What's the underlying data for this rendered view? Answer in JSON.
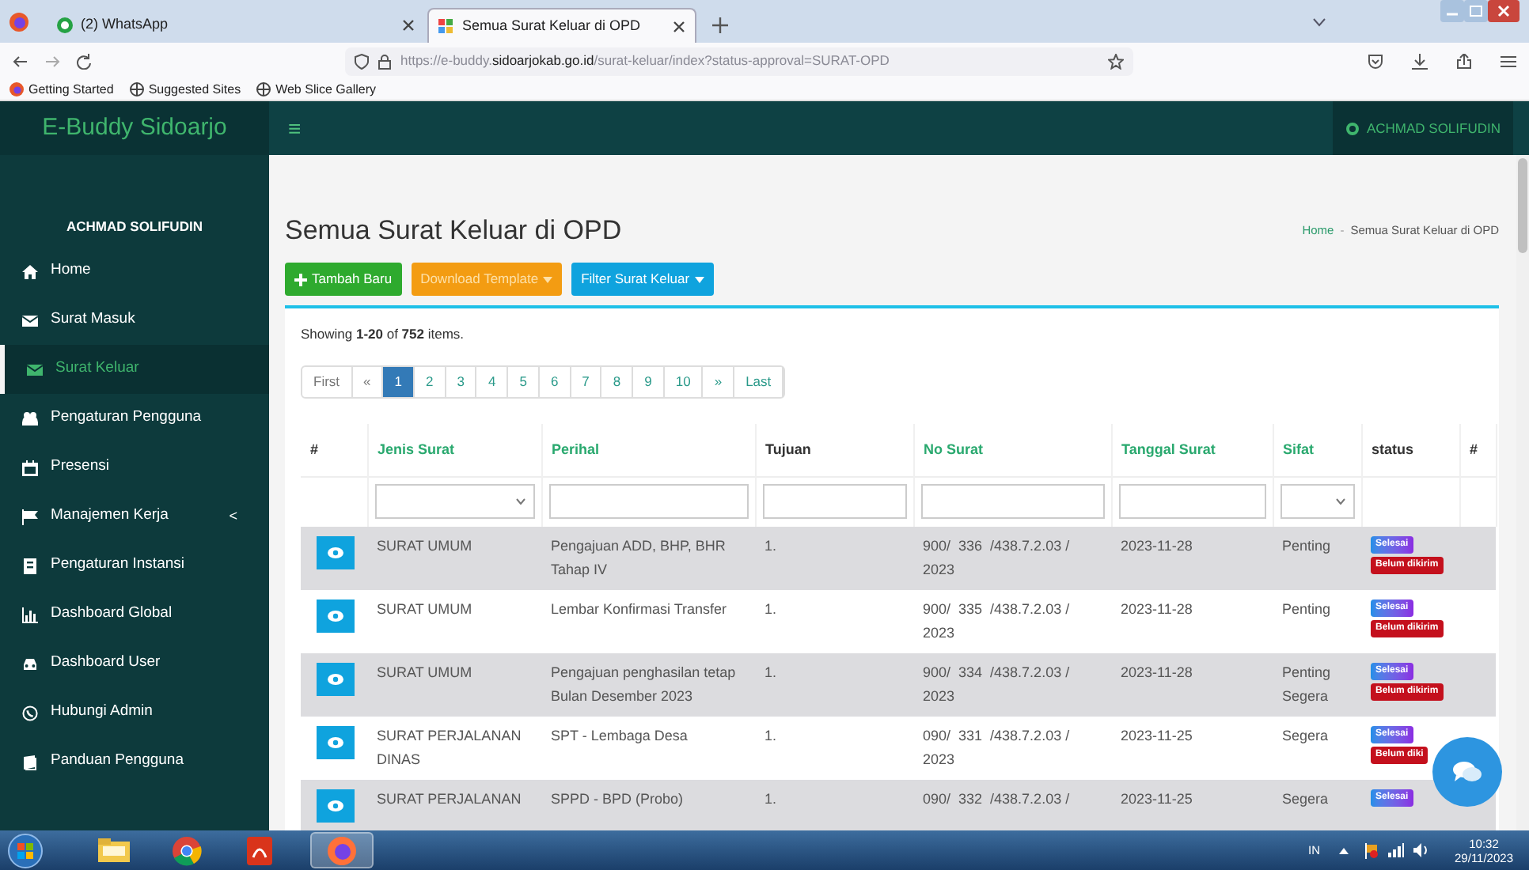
{
  "browser": {
    "tabs": [
      {
        "label": "(2) WhatsApp",
        "selected": false
      },
      {
        "label": "Semua Surat Keluar di OPD",
        "selected": true
      }
    ],
    "url": "https://e-buddy.**sidoarjokab.go.id**/surat-keluar/index?status-approval=SURAT-OPD",
    "bookmarks": [
      "Getting Started",
      "Suggested Sites",
      "Web Slice Gallery"
    ]
  },
  "header": {
    "brand": "E-Buddy Sidoarjo",
    "menu_toggle": "≡",
    "user": "ACHMAD SOLIFUDIN"
  },
  "sidebar": {
    "user": "ACHMAD SOLIFUDIN",
    "items": [
      {
        "label": "Home",
        "selected": false
      },
      {
        "label": "Surat Masuk",
        "selected": false
      },
      {
        "label": "Surat Keluar",
        "selected": true
      },
      {
        "label": "Pengaturan Pengguna",
        "selected": false
      },
      {
        "label": "Presensi",
        "selected": false
      },
      {
        "label": "Manajemen Kerja",
        "selected": false,
        "caret": "<"
      },
      {
        "label": "Pengaturan Instansi",
        "selected": false
      },
      {
        "label": "Dashboard Global",
        "selected": false
      },
      {
        "label": "Dashboard User",
        "selected": false
      },
      {
        "label": "Hubungi Admin",
        "selected": false
      },
      {
        "label": "Panduan Pengguna",
        "selected": false
      }
    ]
  },
  "page": {
    "title": "Semua Surat Keluar di OPD",
    "breadcrumb": [
      "Home",
      "Semua Surat Keluar di OPD"
    ],
    "breadcrumb_separator": "-",
    "buttons": [
      {
        "label": "Tambah Baru",
        "kind": "add"
      },
      {
        "label": "Download Template",
        "kind": "download"
      },
      {
        "label": "Filter Surat Keluar",
        "kind": "filter"
      }
    ],
    "summary": "Showing **1-20** of **752** items.",
    "pagination": [
      {
        "label": "First",
        "selected": false
      },
      {
        "label": "«",
        "selected": false
      },
      {
        "label": "1",
        "selected": true
      },
      {
        "label": "2",
        "selected": false
      },
      {
        "label": "3",
        "selected": false
      },
      {
        "label": "4",
        "selected": false
      },
      {
        "label": "5",
        "selected": false
      },
      {
        "label": "6",
        "selected": false
      },
      {
        "label": "7",
        "selected": false
      },
      {
        "label": "8",
        "selected": false
      },
      {
        "label": "9",
        "selected": false
      },
      {
        "label": "10",
        "selected": false
      },
      {
        "label": "»",
        "selected": false
      },
      {
        "label": "Last",
        "selected": false
      }
    ]
  },
  "table": {
    "columns": [
      {
        "label": "#",
        "sortable": false
      },
      {
        "label": "Jenis Surat",
        "sortable": true
      },
      {
        "label": "Perihal",
        "sortable": true
      },
      {
        "label": "Tujuan",
        "sortable": false
      },
      {
        "label": "No Surat",
        "sortable": true
      },
      {
        "label": "Tanggal Surat",
        "sortable": true
      },
      {
        "label": "Sifat",
        "sortable": true
      },
      {
        "label": "status",
        "sortable": false
      },
      {
        "label": "#",
        "sortable": false
      }
    ],
    "filters": [
      {
        "kind": "none"
      },
      {
        "kind": "select"
      },
      {
        "kind": "text"
      },
      {
        "kind": "text"
      },
      {
        "kind": "text"
      },
      {
        "kind": "text"
      },
      {
        "kind": "select"
      },
      {
        "kind": "none"
      },
      {
        "kind": "none"
      }
    ],
    "rows": [
      {
        "jenis_surat": "SURAT UMUM",
        "perihal": "Pengajuan ADD, BHP, BHR Tahap IV",
        "tujuan": "1.",
        "no_surat": "900/  336  /438.7.2.03 / 2023",
        "tanggal_surat": "2023-11-28",
        "sifat": "Penting",
        "statuses": [
          {
            "label": "Selesai",
            "kind": "done"
          },
          {
            "label": "Belum dikirim",
            "kind": "unsent"
          }
        ]
      },
      {
        "jenis_surat": "SURAT UMUM",
        "perihal": "Lembar Konfirmasi Transfer",
        "tujuan": "1.",
        "no_surat": "900/  335  /438.7.2.03 / 2023",
        "tanggal_surat": "2023-11-28",
        "sifat": "Penting",
        "statuses": [
          {
            "label": "Selesai",
            "kind": "done"
          },
          {
            "label": "Belum dikirim",
            "kind": "unsent"
          }
        ]
      },
      {
        "jenis_surat": "SURAT UMUM",
        "perihal": "Pengajuan penghasilan tetap Bulan Desember 2023",
        "tujuan": "1.",
        "no_surat": "900/  334  /438.7.2.03 / 2023",
        "tanggal_surat": "2023-11-28",
        "sifat": "Penting Segera",
        "statuses": [
          {
            "label": "Selesai",
            "kind": "done"
          },
          {
            "label": "Belum dikirim",
            "kind": "unsent"
          }
        ]
      },
      {
        "jenis_surat": "SURAT PERJALANAN DINAS",
        "perihal": "SPT - Lembaga Desa",
        "tujuan": "1.",
        "no_surat": "090/  331  /438.7.2.03 / 2023",
        "tanggal_surat": "2023-11-25",
        "sifat": "Segera",
        "statuses": [
          {
            "label": "Selesai",
            "kind": "done"
          },
          {
            "label": "Belum diki",
            "kind": "unsent"
          }
        ]
      },
      {
        "jenis_surat": "SURAT PERJALANAN",
        "perihal": "SPPD - BPD (Probo)",
        "tujuan": "1.",
        "no_surat": "090/  332  /438.7.2.03 /",
        "tanggal_surat": "2023-11-25",
        "sifat": "Segera",
        "statuses": [
          {
            "label": "Selesai",
            "kind": "done"
          }
        ]
      }
    ]
  },
  "taskbar": {
    "language": "IN",
    "time": "10:32",
    "date": "29/11/2023"
  }
}
